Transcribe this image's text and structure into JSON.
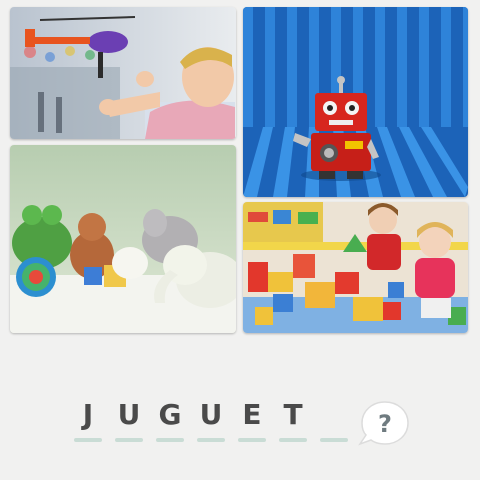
{
  "photos": [
    {
      "name": "boy-helicopter-photo"
    },
    {
      "name": "robot-photo"
    },
    {
      "name": "plush-toys-photo"
    },
    {
      "name": "kids-blocks-photo"
    }
  ],
  "answer": {
    "letters": [
      "J",
      "U",
      "G",
      "U",
      "E",
      "T",
      ""
    ],
    "slot_count": 7
  },
  "hint_button": {
    "icon": "question-bubble-icon",
    "glyph": "?"
  },
  "colors": {
    "background": "#f1f1f0",
    "letter": "#4a4a4a",
    "slot_line": "#c9dcd5",
    "hint_bubble": "#ffffff",
    "hint_glyph": "#6f7b80"
  }
}
